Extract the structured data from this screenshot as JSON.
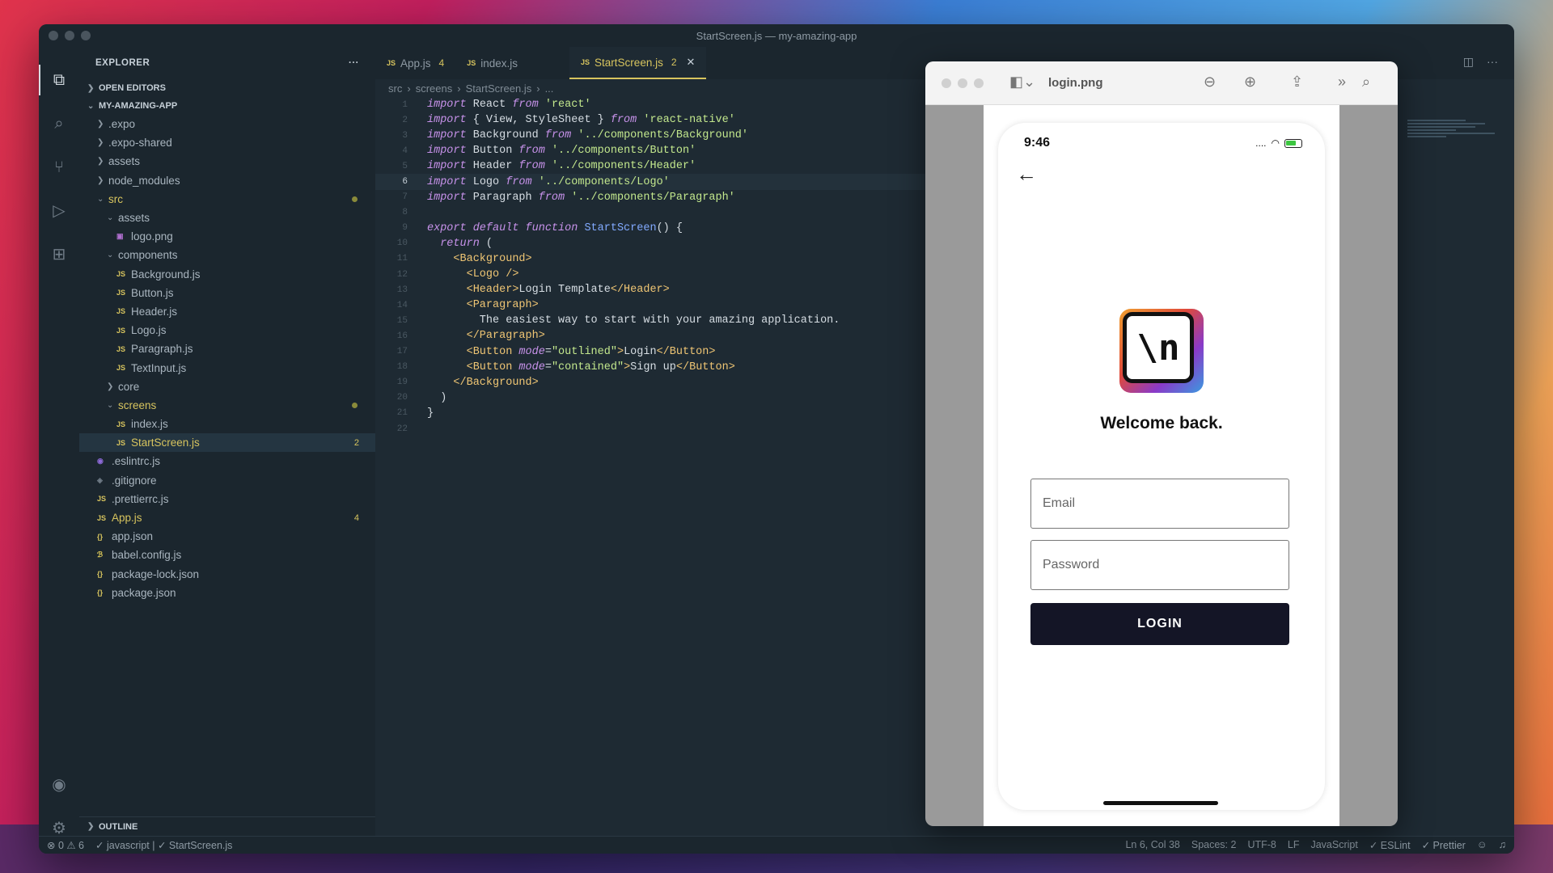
{
  "window": {
    "title": "StartScreen.js — my-amazing-app"
  },
  "sidebar": {
    "title": "EXPLORER",
    "more": "···",
    "open_editors": "OPEN EDITORS",
    "project": "MY-AMAZING-APP",
    "outline": "OUTLINE",
    "tree": [
      {
        "label": ".expo",
        "depth": 1,
        "type": "folder",
        "open": false
      },
      {
        "label": ".expo-shared",
        "depth": 1,
        "type": "folder",
        "open": false
      },
      {
        "label": "assets",
        "depth": 1,
        "type": "folder",
        "open": false
      },
      {
        "label": "node_modules",
        "depth": 1,
        "type": "folder",
        "open": false
      },
      {
        "label": "src",
        "depth": 1,
        "type": "folder",
        "open": true,
        "dot": true,
        "highlight": true
      },
      {
        "label": "assets",
        "depth": 2,
        "type": "folder",
        "open": true
      },
      {
        "label": "logo.png",
        "depth": 3,
        "type": "img"
      },
      {
        "label": "components",
        "depth": 2,
        "type": "folder",
        "open": true
      },
      {
        "label": "Background.js",
        "depth": 3,
        "type": "js"
      },
      {
        "label": "Button.js",
        "depth": 3,
        "type": "js"
      },
      {
        "label": "Header.js",
        "depth": 3,
        "type": "js"
      },
      {
        "label": "Logo.js",
        "depth": 3,
        "type": "js"
      },
      {
        "label": "Paragraph.js",
        "depth": 3,
        "type": "js"
      },
      {
        "label": "TextInput.js",
        "depth": 3,
        "type": "js"
      },
      {
        "label": "core",
        "depth": 2,
        "type": "folder",
        "open": false
      },
      {
        "label": "screens",
        "depth": 2,
        "type": "folder",
        "open": true,
        "dot": true,
        "highlight": true
      },
      {
        "label": "index.js",
        "depth": 3,
        "type": "js"
      },
      {
        "label": "StartScreen.js",
        "depth": 3,
        "type": "js",
        "badge": "2",
        "selected": true,
        "highlight": true
      },
      {
        "label": ".eslintrc.js",
        "depth": 1,
        "type": "lint"
      },
      {
        "label": ".gitignore",
        "depth": 1,
        "type": "git"
      },
      {
        "label": ".prettierrc.js",
        "depth": 1,
        "type": "js"
      },
      {
        "label": "App.js",
        "depth": 1,
        "type": "js",
        "badge": "4",
        "highlight": true
      },
      {
        "label": "app.json",
        "depth": 1,
        "type": "json"
      },
      {
        "label": "babel.config.js",
        "depth": 1,
        "type": "babel"
      },
      {
        "label": "package-lock.json",
        "depth": 1,
        "type": "json"
      },
      {
        "label": "package.json",
        "depth": 1,
        "type": "json"
      }
    ]
  },
  "tabs": [
    {
      "label": "App.js",
      "count": "4",
      "active": false
    },
    {
      "label": "index.js",
      "count": "",
      "active": false
    },
    {
      "label": "StartScreen.js",
      "count": "2",
      "active": true
    }
  ],
  "breadcrumb": [
    "src",
    "screens",
    "StartScreen.js",
    "..."
  ],
  "code": {
    "current_line": 6,
    "lines": [
      [
        [
          "kw",
          "import "
        ],
        [
          "txt",
          "React "
        ],
        [
          "kw",
          "from "
        ],
        [
          "str",
          "'react'"
        ]
      ],
      [
        [
          "kw",
          "import "
        ],
        [
          "txt",
          "{ View, StyleSheet } "
        ],
        [
          "kw",
          "from "
        ],
        [
          "str",
          "'react-native'"
        ]
      ],
      [
        [
          "kw",
          "import "
        ],
        [
          "txt",
          "Background "
        ],
        [
          "kw",
          "from "
        ],
        [
          "str",
          "'../components/Background'"
        ]
      ],
      [
        [
          "kw",
          "import "
        ],
        [
          "txt",
          "Button "
        ],
        [
          "kw",
          "from "
        ],
        [
          "str",
          "'../components/Button'"
        ]
      ],
      [
        [
          "kw",
          "import "
        ],
        [
          "txt",
          "Header "
        ],
        [
          "kw",
          "from "
        ],
        [
          "str",
          "'../components/Header'"
        ]
      ],
      [
        [
          "kw",
          "import "
        ],
        [
          "txt",
          "Logo "
        ],
        [
          "kw",
          "from "
        ],
        [
          "str",
          "'../components/Logo'"
        ]
      ],
      [
        [
          "kw",
          "import "
        ],
        [
          "txt",
          "Paragraph "
        ],
        [
          "kw",
          "from "
        ],
        [
          "str",
          "'../components/Paragraph'"
        ]
      ],
      [],
      [
        [
          "kw",
          "export default function "
        ],
        [
          "fn",
          "StartScreen"
        ],
        [
          "txt",
          "() {"
        ]
      ],
      [
        [
          "txt",
          "  "
        ],
        [
          "kw",
          "return "
        ],
        [
          "txt",
          "("
        ]
      ],
      [
        [
          "txt",
          "    "
        ],
        [
          "tag",
          "<Background>"
        ]
      ],
      [
        [
          "txt",
          "      "
        ],
        [
          "tag",
          "<Logo />"
        ]
      ],
      [
        [
          "txt",
          "      "
        ],
        [
          "tag",
          "<Header>"
        ],
        [
          "txt",
          "Login Template"
        ],
        [
          "tag",
          "</Header>"
        ]
      ],
      [
        [
          "txt",
          "      "
        ],
        [
          "tag",
          "<Paragraph>"
        ]
      ],
      [
        [
          "txt",
          "        The easiest way to start with your amazing application."
        ]
      ],
      [
        [
          "txt",
          "      "
        ],
        [
          "tag",
          "</Paragraph>"
        ]
      ],
      [
        [
          "txt",
          "      "
        ],
        [
          "tag",
          "<Button "
        ],
        [
          "attr",
          "mode"
        ],
        [
          "txt",
          "="
        ],
        [
          "str",
          "\"outlined\""
        ],
        [
          "tag",
          ">"
        ],
        [
          "txt",
          "Login"
        ],
        [
          "tag",
          "</Button>"
        ]
      ],
      [
        [
          "txt",
          "      "
        ],
        [
          "tag",
          "<Button "
        ],
        [
          "attr",
          "mode"
        ],
        [
          "txt",
          "="
        ],
        [
          "str",
          "\"contained\""
        ],
        [
          "tag",
          ">"
        ],
        [
          "txt",
          "Sign up"
        ],
        [
          "tag",
          "</Button>"
        ]
      ],
      [
        [
          "txt",
          "    "
        ],
        [
          "tag",
          "</Background>"
        ]
      ],
      [
        [
          "txt",
          "  )"
        ]
      ],
      [
        [
          "txt",
          "}"
        ]
      ],
      []
    ]
  },
  "preview": {
    "title": "login.png",
    "phone": {
      "time": "9:46",
      "signal": "....",
      "welcome": "Welcome back.",
      "email_placeholder": "Email",
      "password_placeholder": "Password",
      "login_label": "LOGIN",
      "logo_text": "\\n"
    }
  },
  "statusbar": {
    "problems": "⊗ 0 ⚠ 6",
    "language_mode": "✓ javascript | ✓ StartScreen.js",
    "position": "Ln 6, Col 38",
    "spaces": "Spaces: 2",
    "encoding": "UTF-8",
    "eol": "LF",
    "language": "JavaScript",
    "eslint": "✓ ESLint",
    "prettier": "✓ Prettier"
  }
}
